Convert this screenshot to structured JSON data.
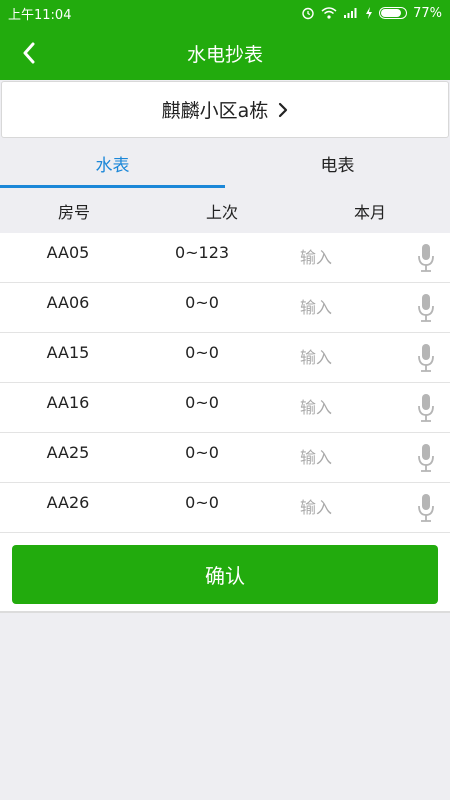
{
  "status_bar": {
    "time": "上午11:04",
    "battery": "77%",
    "battery_level": 0.77
  },
  "app_bar": {
    "title": "水电抄表",
    "back_icon": "chevron-left-icon"
  },
  "building": {
    "name": "麒麟小区a栋",
    "chevron": "›"
  },
  "tabs": [
    {
      "label": "水表",
      "active": true
    },
    {
      "label": "电表",
      "active": false
    }
  ],
  "table": {
    "headers": [
      "房号",
      "上次",
      "本月"
    ],
    "input_placeholder": "输入",
    "rows": [
      {
        "room": "AA05",
        "previous": "0~123"
      },
      {
        "room": "AA06",
        "previous": "0~0"
      },
      {
        "room": "AA15",
        "previous": "0~0"
      },
      {
        "room": "AA16",
        "previous": "0~0"
      },
      {
        "room": "AA25",
        "previous": "0~0"
      },
      {
        "room": "AA26",
        "previous": "0~0"
      }
    ]
  },
  "confirm_label": "确认",
  "colors": {
    "primary": "#22ab0d",
    "tab_active": "#1b87d8",
    "background": "#eeeef2"
  }
}
